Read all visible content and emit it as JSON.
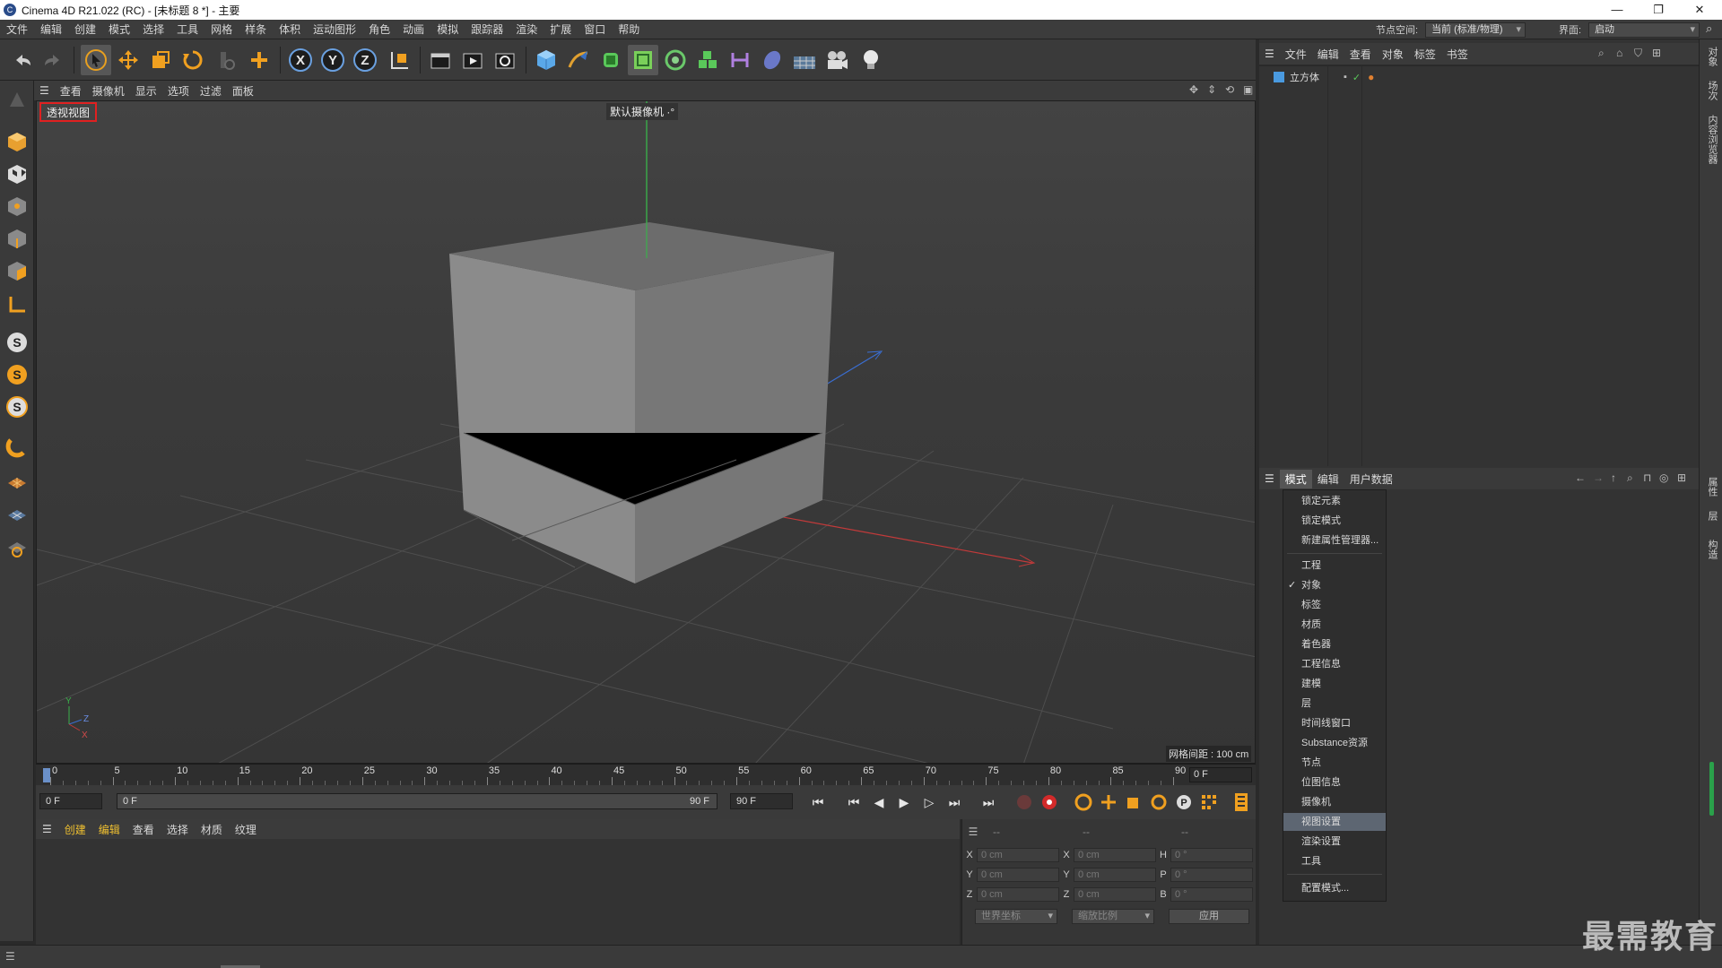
{
  "window": {
    "title": "Cinema 4D R21.022 (RC) - [未标题 8 *] - 主要",
    "logo_letter": "C"
  },
  "window_controls": {
    "minimize": "—",
    "restore": "❐",
    "close": "✕"
  },
  "menubar": {
    "items": [
      "文件",
      "编辑",
      "创建",
      "模式",
      "选择",
      "工具",
      "网格",
      "样条",
      "体积",
      "运动图形",
      "角色",
      "动画",
      "模拟",
      "跟踪器",
      "渲染",
      "扩展",
      "窗口",
      "帮助"
    ],
    "node_space_label": "节点空间:",
    "node_space_value": "当前 (标准/物理)",
    "layout_label": "界面:",
    "layout_value": "启动"
  },
  "toolbar": {
    "axis_x": "X",
    "axis_y": "Y",
    "axis_z": "Z",
    "icons": [
      "undo-icon",
      "redo-icon",
      "select-icon",
      "move-icon",
      "scale-icon",
      "rotate-icon",
      "recent-tools-icon",
      "add-icon",
      "lock-x-icon",
      "lock-y-icon",
      "lock-z-icon",
      "coordinate-system-icon",
      "render-view-icon",
      "render-picture-viewer-icon",
      "render-settings-icon",
      "cube-icon",
      "pen-icon",
      "subdivision-icon",
      "extrude-icon",
      "cloner-icon",
      "array-icon",
      "deformer-icon",
      "field-icon",
      "floor-icon",
      "camera-icon",
      "light-icon"
    ]
  },
  "viewport": {
    "menu": [
      "查看",
      "摄像机",
      "显示",
      "选项",
      "过滤",
      "面板"
    ],
    "view_name": "透视视图",
    "camera_label": "默认摄像机 ·°",
    "grid_spacing": "网格间距 : 100 cm",
    "axis_y": "Y",
    "axis_z": "Z",
    "axis_x": "X"
  },
  "timeline": {
    "ticks": [
      "0",
      "5",
      "10",
      "15",
      "20",
      "25",
      "30",
      "35",
      "40",
      "45",
      "50",
      "55",
      "60",
      "65",
      "70",
      "75",
      "80",
      "85",
      "90"
    ],
    "current_frame": "0 F"
  },
  "playbar": {
    "start_frame": "0 F",
    "range_start": "0 F",
    "range_end": "90 F",
    "end_frame": "90 F",
    "keyframe_p": "P"
  },
  "material_manager": {
    "menu": [
      "创建",
      "编辑",
      "查看",
      "选择",
      "材质",
      "纹理"
    ]
  },
  "coordinates": {
    "header": [
      "--",
      "--",
      "--"
    ],
    "rows": [
      {
        "a": "X",
        "av": "0 cm",
        "b": "X",
        "bv": "0 cm",
        "c": "H",
        "cv": "0 °"
      },
      {
        "a": "Y",
        "av": "0 cm",
        "b": "Y",
        "bv": "0 cm",
        "c": "P",
        "cv": "0 °"
      },
      {
        "a": "Z",
        "av": "0 cm",
        "b": "Z",
        "bv": "0 cm",
        "c": "B",
        "cv": "0 °"
      }
    ],
    "coord_mode": "世界坐标",
    "scale_mode": "缩放比例",
    "apply_label": "应用"
  },
  "object_manager": {
    "menu": [
      "文件",
      "编辑",
      "查看",
      "对象",
      "标签",
      "书签"
    ],
    "object_name": "立方体"
  },
  "attribute_manager": {
    "menu": [
      "模式",
      "编辑",
      "用户数据"
    ],
    "dropdown": {
      "group1": [
        "锁定元素",
        "锁定模式",
        "新建属性管理器..."
      ],
      "group2": [
        "工程",
        "对象",
        "标签",
        "材质",
        "着色器",
        "工程信息",
        "建模",
        "层",
        "时间线窗口",
        "Substance资源",
        "节点",
        "位图信息",
        "摄像机",
        "视图设置",
        "渲染设置",
        "工具"
      ],
      "group3": [
        "配置模式..."
      ],
      "checked": "对象",
      "selected": "视图设置"
    }
  },
  "right_tabs": [
    "对象",
    "场次",
    "内容浏览器",
    "属性",
    "层",
    "构造"
  ],
  "watermark": "最需教育",
  "colors": {
    "accent_red": "#e02020",
    "selected_bg": "#5d6672",
    "axis_x": "#d23a3a",
    "axis_y": "#3ab04a",
    "axis_z": "#3a6ed2"
  }
}
